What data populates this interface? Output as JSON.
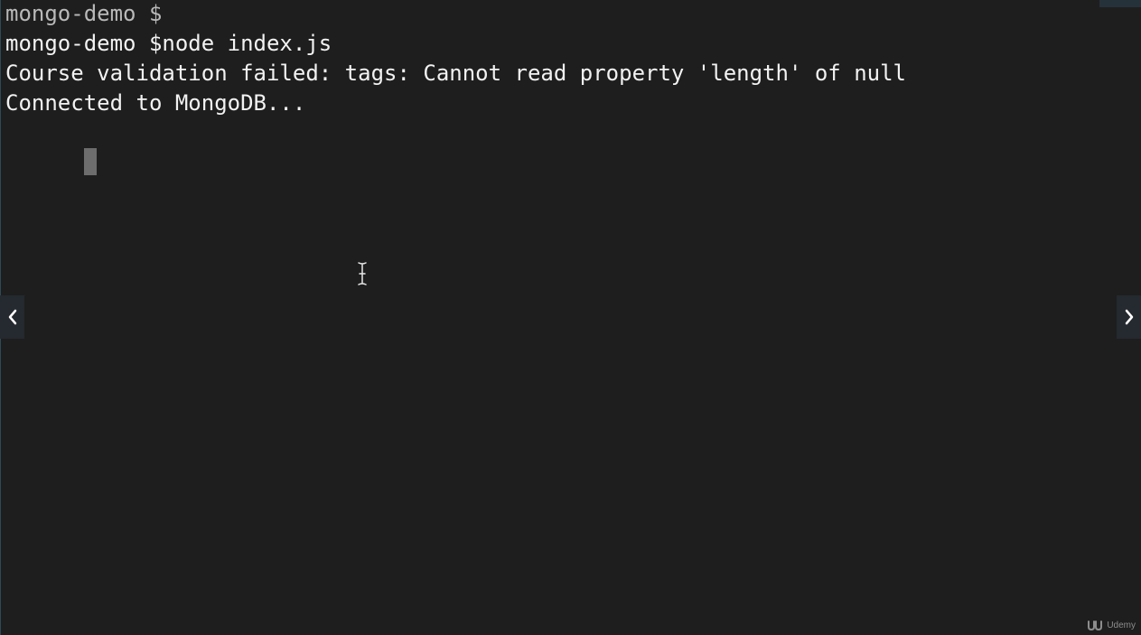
{
  "terminal": {
    "lines": [
      "mongo-demo $",
      "mongo-demo $node index.js",
      "Course validation failed: tags: Cannot read property 'length' of null",
      "Connected to MongoDB..."
    ]
  },
  "navigation": {
    "prev_icon": "chevron-left-icon",
    "next_icon": "chevron-right-icon"
  },
  "watermark": {
    "brand": "Udemy",
    "icon": "udemy-logo-icon"
  },
  "colors": {
    "background": "#1e1e1e",
    "text": "#f2f2f2",
    "cursor": "#6d6d6d"
  }
}
